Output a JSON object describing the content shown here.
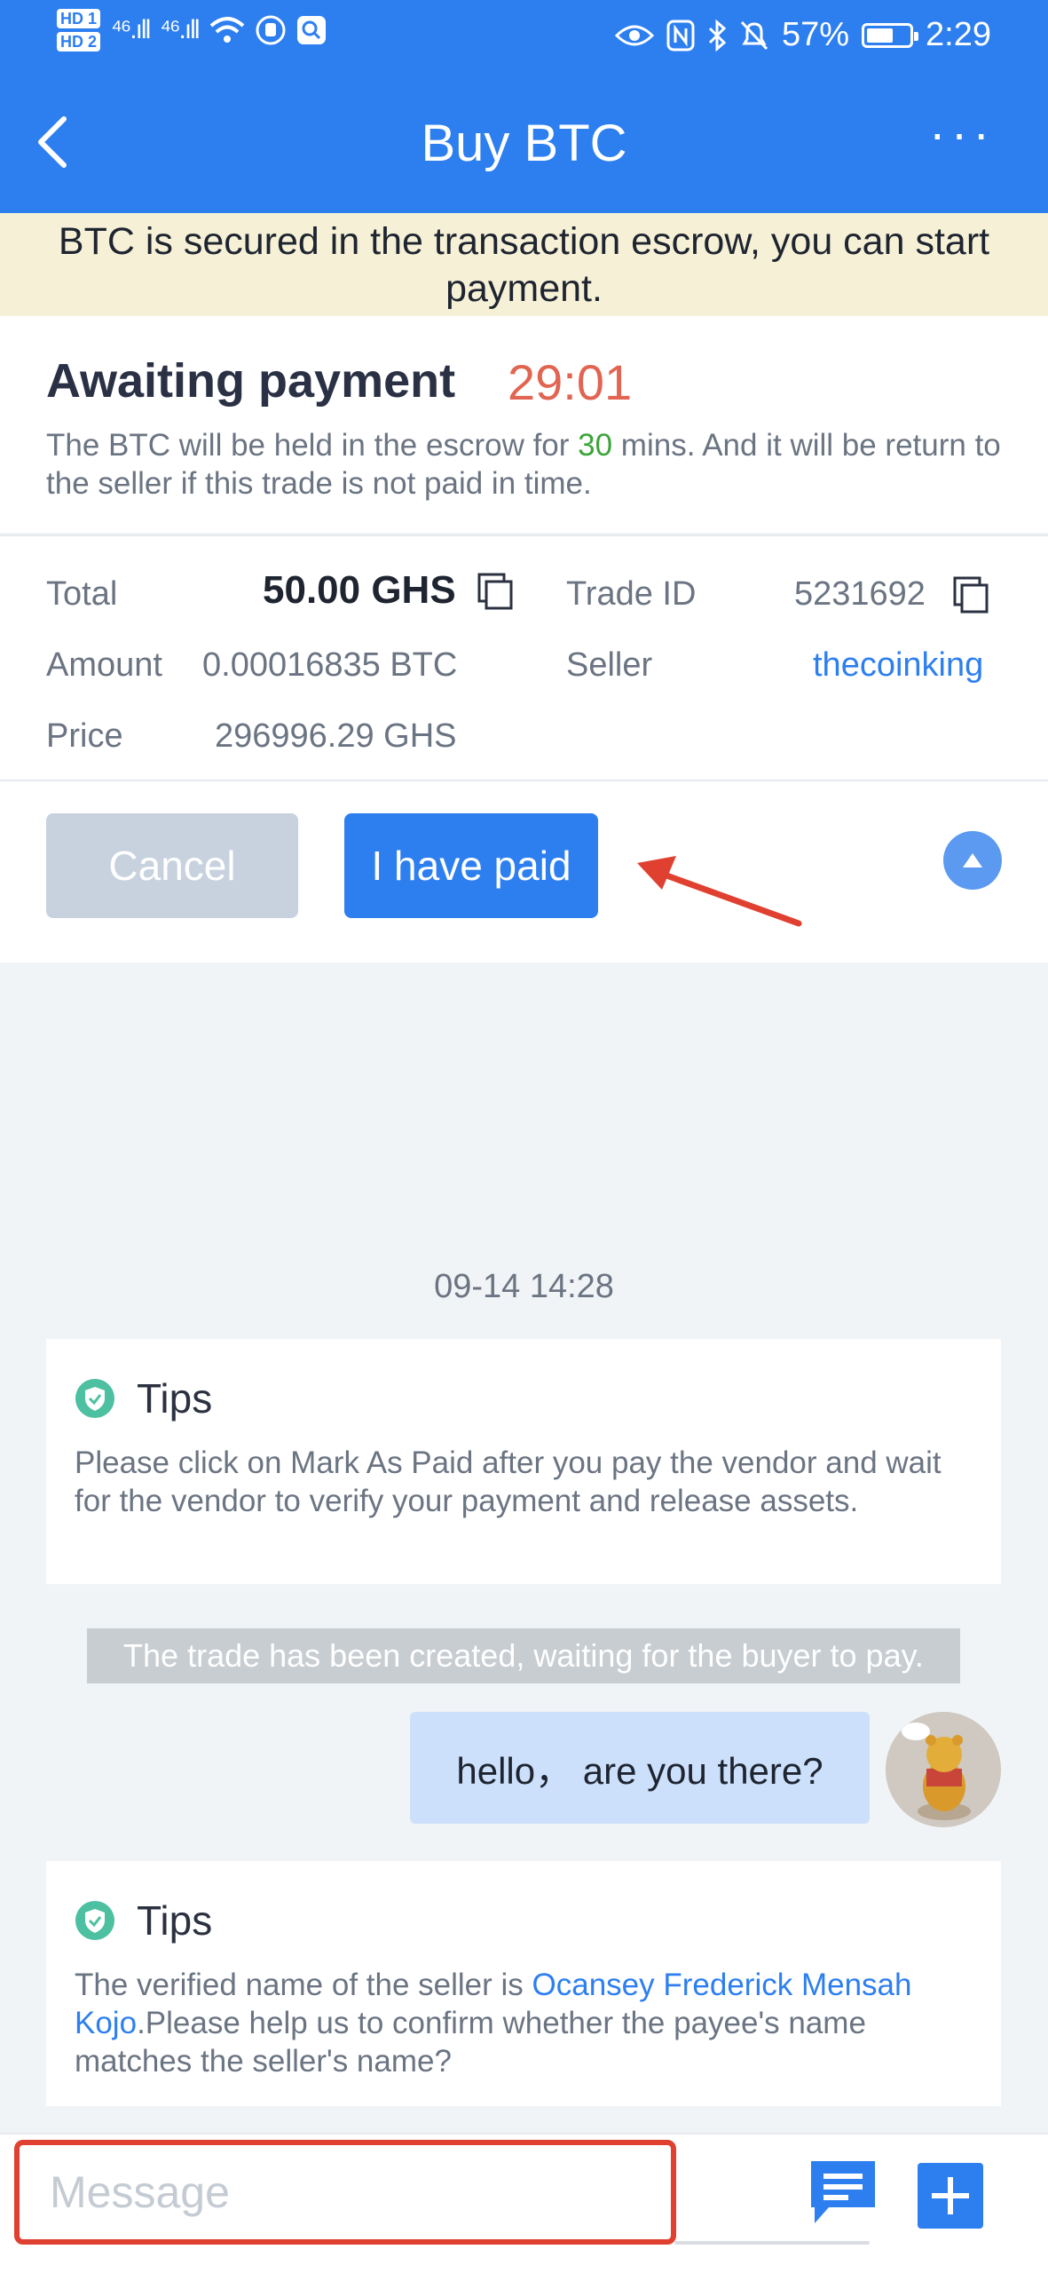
{
  "status_bar": {
    "hd1": "HD 1",
    "hd2": "HD 2",
    "sig1": "⁴⁶.ıll",
    "sig2": "⁴⁶.ıll",
    "battery": "57%",
    "time": "2:29"
  },
  "header": {
    "title": "Buy BTC",
    "more": "···",
    "color": "#2d7ff0"
  },
  "banner": {
    "text": "BTC is secured in the transaction escrow, you can start payment."
  },
  "awaiting": {
    "title": "Awaiting payment",
    "timer": "29:01",
    "desc_before": "The BTC will be held in the escrow for ",
    "desc_minutes": "30",
    "desc_after": " mins. And it will be return to the seller if this trade is not paid in time."
  },
  "details": {
    "total_label": "Total",
    "total_value": "50.00 GHS",
    "trade_id_label": "Trade ID",
    "trade_id_value": "5231692",
    "amount_label": "Amount",
    "amount_value": "0.00016835 BTC",
    "seller_label": "Seller",
    "seller_value": "thecoinking",
    "price_label": "Price",
    "price_value": "296996.29 GHS"
  },
  "actions": {
    "cancel_label": "Cancel",
    "paid_label": "I have paid"
  },
  "chat": {
    "timestamp": "09-14 14:28",
    "tips1": {
      "title": "Tips",
      "body": "Please click on Mark As Paid after you pay the vendor and wait for the vendor to verify your payment and release assets."
    },
    "system_message": "The trade has been created, waiting for the buyer to pay.",
    "user_message": "hello， are  you there?",
    "tips2": {
      "title": "Tips",
      "body_before": "The verified name of the seller is ",
      "seller_name": "Ocansey Frederick Mensah Kojo",
      "body_after": ".Please help us to confirm whether the payee's name matches the seller's name?"
    }
  },
  "input_bar": {
    "placeholder": "Message"
  }
}
